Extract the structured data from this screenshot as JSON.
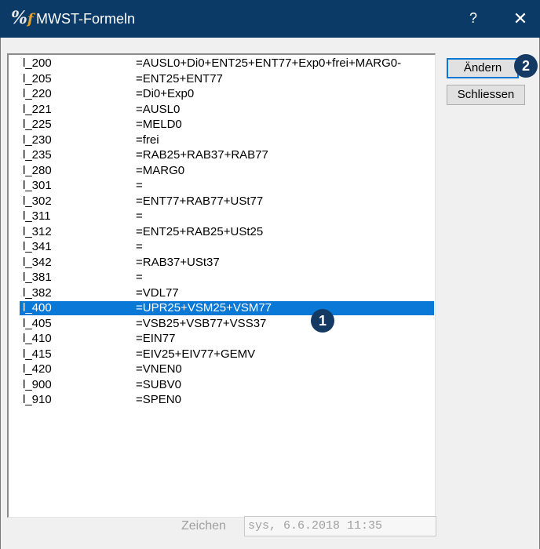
{
  "window": {
    "title": "MWST-Formeln",
    "help_label": "?",
    "close_label": "✕"
  },
  "list": {
    "selected_index": 16,
    "items": [
      {
        "name": "l_200",
        "formula": "=AUSL0+Di0+ENT25+ENT77+Exp0+frei+MARG0-"
      },
      {
        "name": "l_205",
        "formula": "=ENT25+ENT77"
      },
      {
        "name": "l_220",
        "formula": "=Di0+Exp0"
      },
      {
        "name": "l_221",
        "formula": "=AUSL0"
      },
      {
        "name": "l_225",
        "formula": "=MELD0"
      },
      {
        "name": "l_230",
        "formula": "=frei"
      },
      {
        "name": "l_235",
        "formula": "=RAB25+RAB37+RAB77"
      },
      {
        "name": "l_280",
        "formula": "=MARG0"
      },
      {
        "name": "l_301",
        "formula": "="
      },
      {
        "name": "l_302",
        "formula": "=ENT77+RAB77+USt77"
      },
      {
        "name": "l_311",
        "formula": "="
      },
      {
        "name": "l_312",
        "formula": "=ENT25+RAB25+USt25"
      },
      {
        "name": "l_341",
        "formula": "="
      },
      {
        "name": "l_342",
        "formula": "=RAB37+USt37"
      },
      {
        "name": "l_381",
        "formula": "="
      },
      {
        "name": "l_382",
        "formula": "=VDL77"
      },
      {
        "name": "l_400",
        "formula": "=UPR25+VSM25+VSM77"
      },
      {
        "name": "l_405",
        "formula": "=VSB25+VSB77+VSS37"
      },
      {
        "name": "l_410",
        "formula": "=EIN77"
      },
      {
        "name": "l_415",
        "formula": "=EIV25+EIV77+GEMV"
      },
      {
        "name": "l_420",
        "formula": "=VNEN0"
      },
      {
        "name": "l_900",
        "formula": "=SUBV0"
      },
      {
        "name": "l_910",
        "formula": "=SPEN0"
      }
    ]
  },
  "buttons": {
    "change_label": "Ändern",
    "close_label": "Schliessen"
  },
  "footer": {
    "zeichen_label": "Zeichen",
    "zeichen_value": "sys, 6.6.2018 11:35"
  },
  "callouts": {
    "one": "1",
    "two": "2"
  },
  "colors": {
    "titlebar": "#0b3a66",
    "selection": "#0a78d7",
    "callout": "#143a63"
  }
}
